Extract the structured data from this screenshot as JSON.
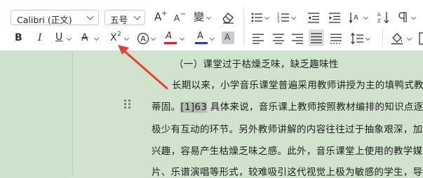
{
  "toolbar": {
    "font_name": "Calibri (正文)",
    "font_size": "五号",
    "icons": {
      "increase_font": "A⁺",
      "decrease_font": "A⁻",
      "phonetic": "變",
      "clear_format": "eraser-icon",
      "bold": "B",
      "italic": "I",
      "underline": "U",
      "strikethrough": "A",
      "superscript": "X²",
      "char_shading": "A",
      "highlight": "A",
      "font_color": "A",
      "char_border": "A"
    },
    "colors": {
      "highlight_bar": "#e02020",
      "font_color_bar": "#1f3fcf",
      "arrow": "#e8402c"
    }
  },
  "document": {
    "heading": "（一）课堂过于枯燥乏味，缺乏趣味性",
    "lines": [
      "长期以来，小学音乐课堂普遍采用教师讲授为主的填鸭式教",
      "蒂固。",
      "[1]63",
      " 具体来说，音乐课上教师按照教材编排的知识点逐",
      "极少有互动的环节。另外教师讲解的内容往往过于抽象艰深，加",
      "兴趣，容易产生枯燥乏味之感。此外，音乐课堂上使用的教学媒",
      "片、乐谱演唱等形式，较难吸引这代视觉上极为敏感的学生，导"
    ]
  }
}
